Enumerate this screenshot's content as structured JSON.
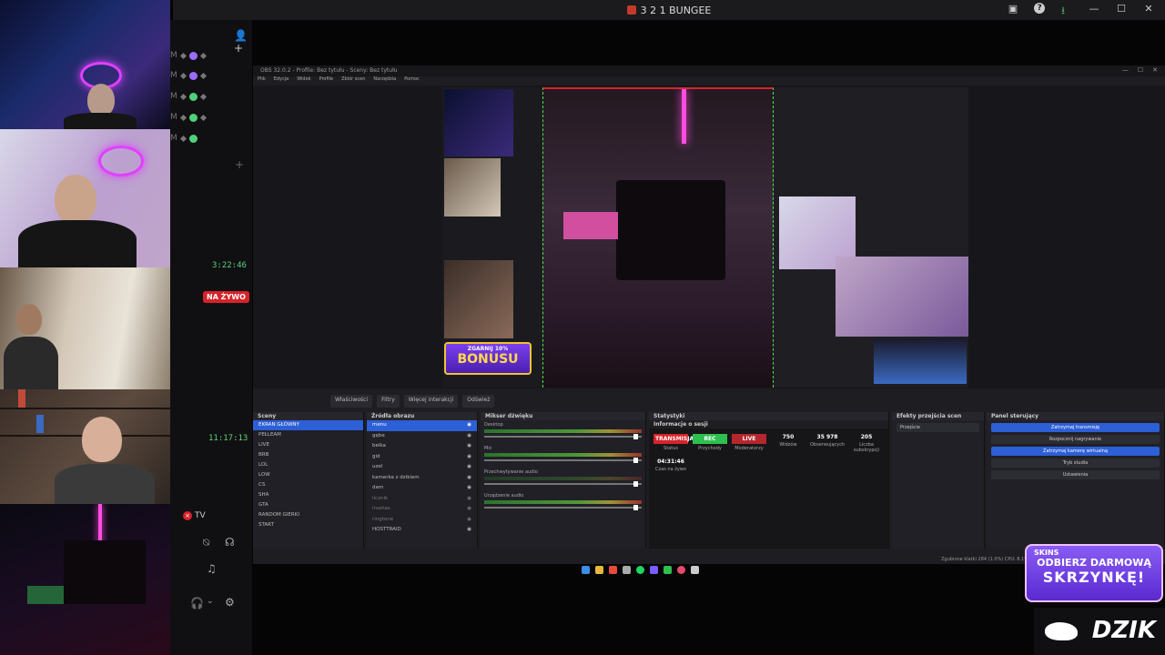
{
  "window": {
    "title": "3 2 1 BUNGEE",
    "controls": [
      "—",
      "☐",
      "✕"
    ],
    "icons": [
      "frame-icon",
      "help-icon",
      "download-icon"
    ]
  },
  "sidebar": {
    "rows": [
      {
        "letter": "M",
        "dot": "purple"
      },
      {
        "letter": "M",
        "dot": "purple"
      },
      {
        "letter": "M",
        "dot": "green"
      },
      {
        "letter": "M",
        "dot": "green"
      },
      {
        "letter": "M",
        "dot": "green"
      }
    ],
    "timestamp_1": "3:22:46",
    "live_badge": "NA ŻYWO",
    "timestamp_2": "11:17:13",
    "tv_label": "TV"
  },
  "obs": {
    "title": "OBS 32.0.2 - Profile: Bez tytułu - Sceny: Bez tytułu",
    "menu": [
      "Plik",
      "Edycja",
      "Widok",
      "Profile",
      "Zbiór scen",
      "Narzędzia",
      "Pomoc"
    ],
    "dock_tabs": [
      "Właściwości",
      "Filtry",
      "Więcej interakcji",
      "Odśwież"
    ],
    "bonus": {
      "line1": "ZGARNIJ 10%",
      "line2": "BONUSU"
    },
    "panels": {
      "scenes": {
        "title": "Sceny",
        "items": [
          "EKRAN GŁÓWNY",
          "PEŁLEAM",
          "LIVE",
          "BRB",
          "LOL",
          "LOW",
          "CS",
          "SHA",
          "GTA",
          "RANDOM GIERKI",
          "START"
        ],
        "selected_index": 0
      },
      "sources": {
        "title": "Źródła obrazu",
        "items": [
          "menu",
          "gębe",
          "belka",
          "gid",
          "uzel",
          "kamerka z dzikiem",
          "dam",
          "licznik",
          "insetas",
          "ringtone",
          "HOSTTRAID"
        ]
      },
      "mixer": {
        "title": "Mikser dźwięku",
        "tracks": [
          "Desktop",
          "Mic",
          "Przechwytywanie audio",
          "Urządzenie audio"
        ]
      },
      "stats": {
        "title": "Statystyki",
        "subtitle": "Informacje o sesji",
        "tiles": [
          {
            "value": "TRANSMISJA",
            "label": "Status",
            "style": "red"
          },
          {
            "value": "REC",
            "label": "Przychody",
            "style": "green"
          },
          {
            "value": "LIVE",
            "label": "Moderatorzy",
            "style": "redd"
          },
          {
            "value": "750",
            "label": "Widzów",
            "style": "plain"
          },
          {
            "value": "35 978",
            "label": "Obserwujących",
            "style": "plain"
          },
          {
            "value": "205",
            "label": "Liczba subskrypcji",
            "style": "plain"
          },
          {
            "value": "04:31:46",
            "label": "Czas na żywo",
            "style": "plain"
          }
        ]
      },
      "transitions": {
        "title": "Efekty przejścia scen",
        "selected": "Przejście"
      },
      "controls": {
        "title": "Panel sterujący",
        "buttons": [
          "Zatrzymaj transmisję",
          "Rozpocznij nagrywanie",
          "Zatrzymaj kamerę wirtualną",
          "Tryb studia",
          "Ustawienia"
        ],
        "active": [
          0,
          2
        ]
      }
    },
    "status_text": "Zgubione klatki 284 (1.0%)  CPU: 8.1%"
  },
  "promo": {
    "brand": "SKINS",
    "line1": "ODBIERZ DARMOWĄ",
    "line2": "SKRZYNKĘ!"
  },
  "logo": {
    "text": "DZIK"
  }
}
